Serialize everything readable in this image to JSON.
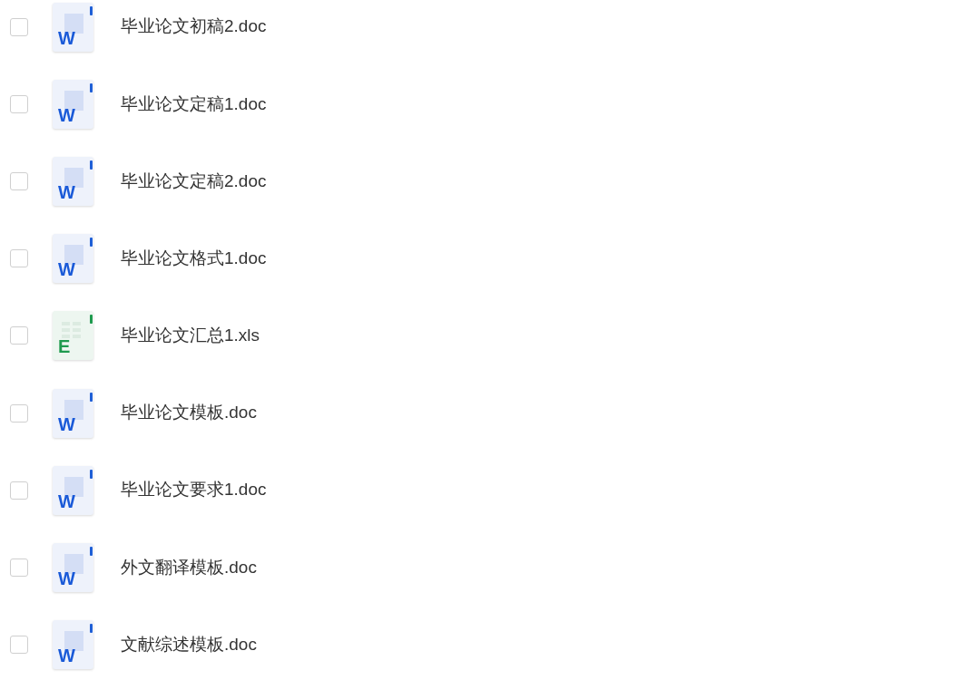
{
  "files": [
    {
      "name": "毕业论文初稿2.doc",
      "kind": "doc",
      "icon_label": "W",
      "checked": false
    },
    {
      "name": "毕业论文定稿1.doc",
      "kind": "doc",
      "icon_label": "W",
      "checked": false
    },
    {
      "name": "毕业论文定稿2.doc",
      "kind": "doc",
      "icon_label": "W",
      "checked": false
    },
    {
      "name": "毕业论文格式1.doc",
      "kind": "doc",
      "icon_label": "W",
      "checked": false
    },
    {
      "name": "毕业论文汇总1.xls",
      "kind": "xls",
      "icon_label": "E",
      "checked": false
    },
    {
      "name": "毕业论文模板.doc",
      "kind": "doc",
      "icon_label": "W",
      "checked": false
    },
    {
      "name": "毕业论文要求1.doc",
      "kind": "doc",
      "icon_label": "W",
      "checked": false
    },
    {
      "name": "外文翻译模板.doc",
      "kind": "doc",
      "icon_label": "W",
      "checked": false
    },
    {
      "name": "文献综述模板.doc",
      "kind": "doc",
      "icon_label": "W",
      "checked": false
    }
  ]
}
